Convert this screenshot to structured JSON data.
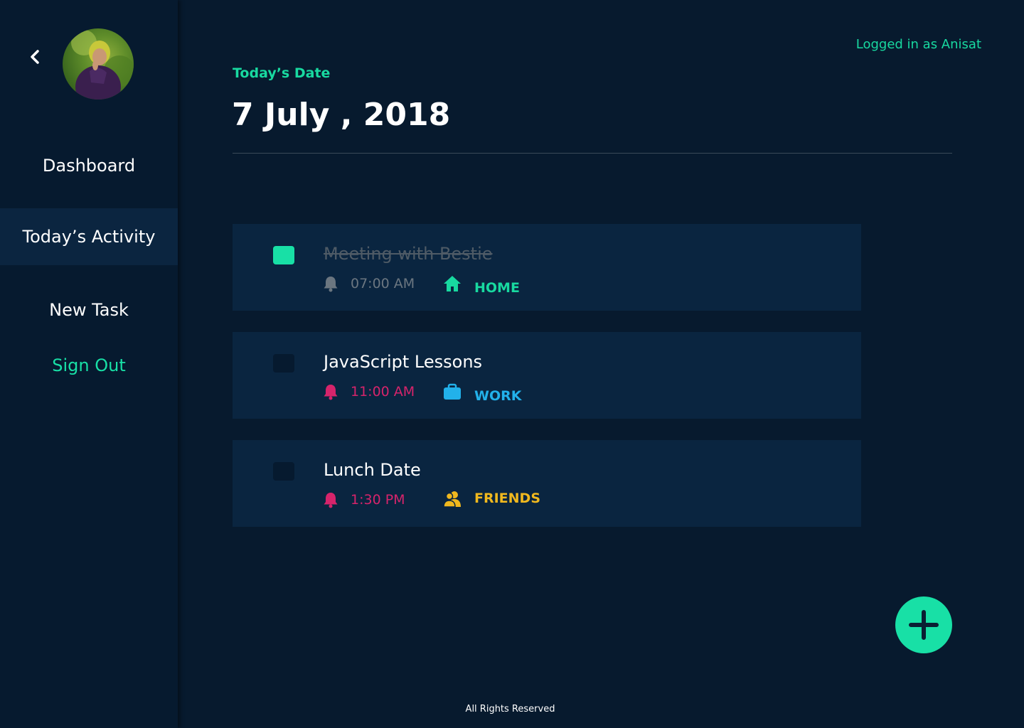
{
  "header": {
    "logged_in_text": "Logged in as Anisat",
    "date_label": "Today’s Date",
    "date_value": "7 July , 2018"
  },
  "sidebar": {
    "items": [
      {
        "label": "Dashboard",
        "active": false
      },
      {
        "label": "Today’s Activity",
        "active": true
      },
      {
        "label": "New Task",
        "active": false
      },
      {
        "label": "Sign Out",
        "active": false
      }
    ]
  },
  "tasks": [
    {
      "title": "Meeting with Bestie",
      "done": true,
      "time": "07:00 AM",
      "category": "HOME",
      "category_icon": "home-icon",
      "time_color": "#6b7680",
      "category_color": "#18d9a0"
    },
    {
      "title": "JavaScript Lessons",
      "done": false,
      "time": "11:00 AM",
      "category": "WORK",
      "category_icon": "briefcase-icon",
      "time_color": "#d6246b",
      "category_color": "#22b1ea"
    },
    {
      "title": "Lunch Date",
      "done": false,
      "time": "1:30 PM",
      "category": "FRIENDS",
      "category_icon": "friends-icon",
      "time_color": "#d6246b",
      "category_color": "#f0b81e"
    }
  ],
  "footer": {
    "text": "All Rights Reserved"
  },
  "colors": {
    "accent": "#18e0a6",
    "background": "#071a2e",
    "card": "#0a2540"
  }
}
